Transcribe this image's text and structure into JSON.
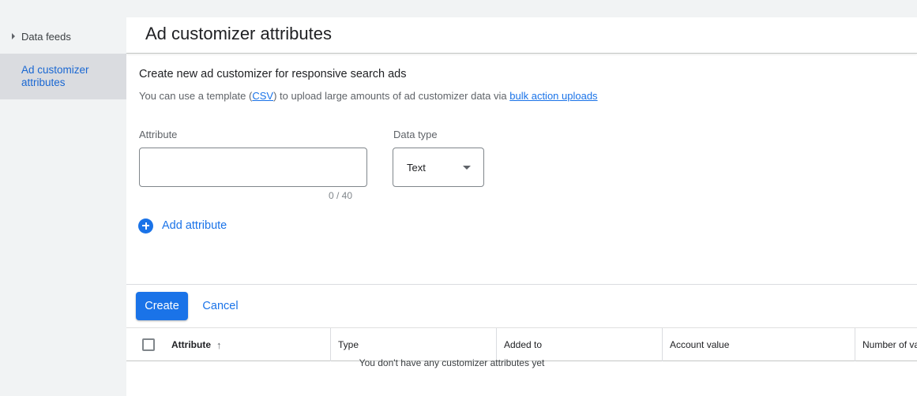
{
  "sidebar": {
    "items": [
      {
        "label": "Data feeds"
      },
      {
        "label": "Ad customizer attributes"
      }
    ]
  },
  "page": {
    "title": "Ad customizer attributes"
  },
  "form": {
    "section_title": "Create new ad customizer for responsive search ads",
    "help": {
      "prefix": "You can use a template (",
      "csv_link": "CSV",
      "middle": ") to upload large amounts of ad customizer data via ",
      "bulk_link": "bulk action uploads"
    },
    "attribute_label": "Attribute",
    "attribute_value": "",
    "attribute_counter": "0 / 40",
    "data_type_label": "Data type",
    "data_type_value": "Text",
    "add_attribute_label": "Add attribute",
    "create_label": "Create",
    "cancel_label": "Cancel"
  },
  "table": {
    "columns": [
      "Attribute",
      "Type",
      "Added to",
      "Account value",
      "Number of va"
    ],
    "sort_indicator": "↑",
    "empty_message": "You don't have any customizer attributes yet"
  },
  "colors": {
    "accent": "#1a73e8",
    "sidebar_active_bg": "#dadce0",
    "sidebar_active_text": "#1967d2",
    "page_bg": "#f1f3f4"
  }
}
